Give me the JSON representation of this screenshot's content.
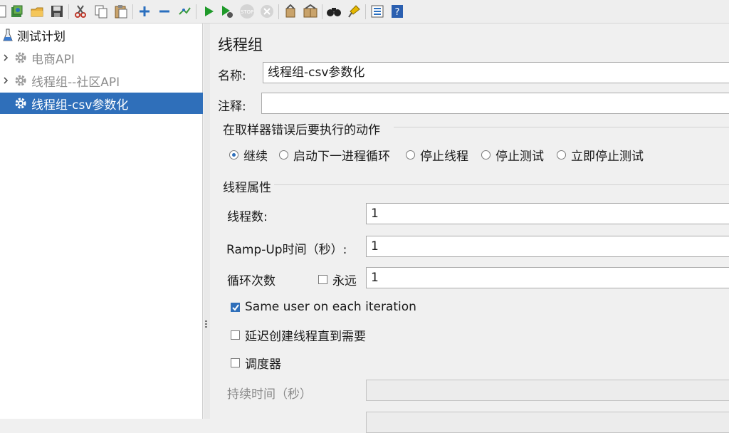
{
  "toolbar": {
    "icons": [
      "new-icon",
      "templates-icon",
      "open-icon",
      "save-icon",
      "cut-icon",
      "copy-icon",
      "paste-icon",
      "expand-icon",
      "collapse-icon",
      "toggle-icon",
      "start-icon",
      "start-no-pause-icon",
      "stop-icon",
      "shutdown-icon",
      "clear-icon",
      "clear-all-icon",
      "search-icon",
      "reset-search-icon",
      "function-helper-icon",
      "help-icon"
    ]
  },
  "tree": {
    "items": [
      {
        "label": "测试计划",
        "icon": "test-plan-icon",
        "state": "normal"
      },
      {
        "label": "电商API",
        "icon": "gear-icon",
        "state": "disabled"
      },
      {
        "label": "线程组--社区API",
        "icon": "gear-icon",
        "state": "disabled"
      },
      {
        "label": "线程组-csv参数化",
        "icon": "gear-icon",
        "state": "selected"
      }
    ]
  },
  "main": {
    "title": "线程组",
    "name_label": "名称:",
    "name_value": "线程组-csv参数化",
    "comment_label": "注释:",
    "comment_value": "",
    "error_section_title": "在取样器错误后要执行的动作",
    "error_actions": [
      {
        "label": "继续",
        "selected": true
      },
      {
        "label": "启动下一进程循环",
        "selected": false
      },
      {
        "label": "停止线程",
        "selected": false
      },
      {
        "label": "停止测试",
        "selected": false
      },
      {
        "label": "立即停止测试",
        "selected": false
      }
    ],
    "thread_section_title": "线程属性",
    "threads_label": "线程数:",
    "threads_value": "1",
    "rampup_label": "Ramp-Up时间（秒）:",
    "rampup_value": "1",
    "loop_label": "循环次数",
    "forever_label": "永远",
    "forever_checked": false,
    "loop_value": "1",
    "same_user_label": "Same user on each iteration",
    "same_user_checked": true,
    "delay_label": "延迟创建线程直到需要",
    "delay_checked": false,
    "scheduler_label": "调度器",
    "scheduler_checked": false,
    "duration_label": "持续时间（秒）",
    "duration_value": ""
  },
  "colors": {
    "selection": "#2f6fba",
    "background": "#f0f0f0"
  }
}
